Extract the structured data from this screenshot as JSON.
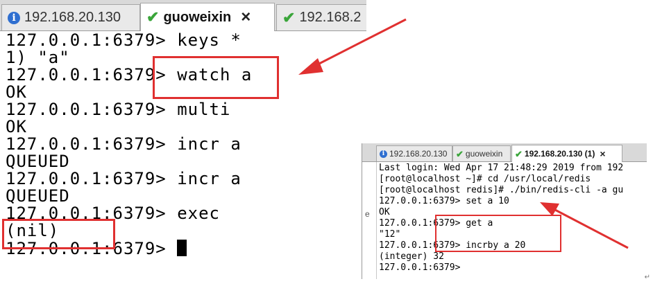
{
  "left_window": {
    "tabs": [
      {
        "label": "192.168.20.130",
        "icon": "info-icon"
      },
      {
        "label": "guoweixin",
        "icon": "check-icon",
        "close": "×"
      },
      {
        "label": "192.168.2",
        "icon": "check-icon"
      }
    ],
    "lines": [
      "127.0.0.1:6379> keys *",
      "1) \"a\"",
      "127.0.0.1:6379> watch a",
      "OK",
      "127.0.0.1:6379> multi",
      "OK",
      "127.0.0.1:6379> incr a",
      "QUEUED",
      "127.0.0.1:6379> incr a",
      "QUEUED",
      "127.0.0.1:6379> exec",
      "(nil)",
      "127.0.0.1:6379> "
    ]
  },
  "right_window": {
    "tabs": [
      {
        "label": "192.168.20.130",
        "icon": "info-icon"
      },
      {
        "label": "guoweixin",
        "icon": "check-icon"
      },
      {
        "label": "192.168.20.130 (1)",
        "icon": "check-icon",
        "close": "×"
      }
    ],
    "gutter_char": "e",
    "lines": [
      "Last login: Wed Apr 17 21:48:29 2019 from 192",
      "[root@localhost ~]# cd /usr/local/redis",
      "[root@localhost redis]# ./bin/redis-cli -a gu",
      "127.0.0.1:6379> set a 10",
      "OK",
      "127.0.0.1:6379> get a",
      "\"12\"",
      "127.0.0.1:6379> incrby a 20",
      "(integer) 32",
      "127.0.0.1:6379>"
    ]
  },
  "colors": {
    "highlight": "#e03030",
    "arrow": "#e03030"
  },
  "corner_mark": "↵"
}
